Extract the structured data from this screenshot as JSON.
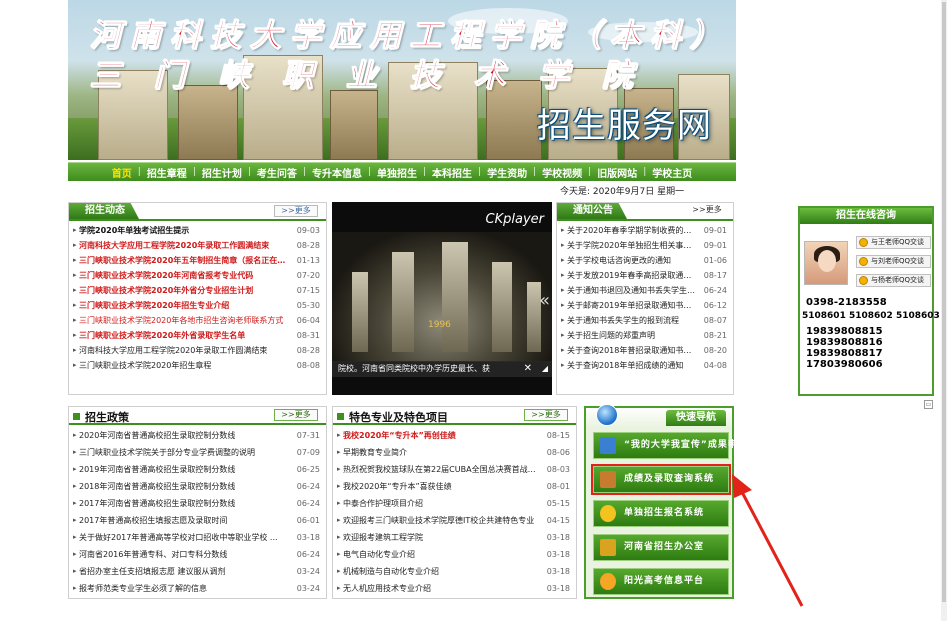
{
  "banner": {
    "title_line1": "河南科技大学应用工程学院（本科）",
    "title_line2": "三门峡职业技术学院",
    "service_title": "招生服务网"
  },
  "nav": {
    "items": [
      "首页",
      "招生章程",
      "招生计划",
      "考生问答",
      "专升本信息",
      "单独招生",
      "本科招生",
      "学生资助",
      "学校视频",
      "旧版网站",
      "学校主页"
    ]
  },
  "date_text": "今天是: 2020年9月7日 星期一",
  "news": {
    "title": "招生动态",
    "more": ">>更多",
    "items": [
      {
        "text": "学院2020年单独考试招生提示",
        "date": "09-03",
        "style": "bold"
      },
      {
        "text": "河南科技大学应用工程学院2020年录取工作圆满结束",
        "date": "08-28",
        "style": "red"
      },
      {
        "text": "三门峡职业技术学院2020年五年制招生简章（报名正在进行中）",
        "date": "01-13",
        "style": "red"
      },
      {
        "text": "三门峡职业技术学院2020年河南省报考专业代码",
        "date": "07-20",
        "style": "red"
      },
      {
        "text": "三门峡职业技术学院2020年外省分专业招生计划",
        "date": "07-15",
        "style": "red"
      },
      {
        "text": "三门峡职业技术学院2020年招生专业介绍",
        "date": "05-30",
        "style": "red"
      },
      {
        "text": "三门峡职业技术学院2020年各地市招生咨询老师联系方式",
        "date": "06-04",
        "style": "redn"
      },
      {
        "text": "三门峡职业技术学院2020年外省录取学生名单",
        "date": "08-31",
        "style": "red"
      },
      {
        "text": "河南科技大学应用工程学院2020年录取工作圆满结束",
        "date": "08-28",
        "style": "normal"
      },
      {
        "text": "三门峡职业技术学院2020年招生章程",
        "date": "08-08",
        "style": "normal"
      }
    ]
  },
  "video": {
    "player_label": "CKplayer",
    "year_text": "1996",
    "caption": "院校。河南省同类院校中办学历史最长、获",
    "close": "✕",
    "arrow": "«"
  },
  "notices": {
    "title": "通知公告",
    "more": ">>更多",
    "items": [
      {
        "text": "关于2020年春季学期学制收费的声明",
        "date": "09-01"
      },
      {
        "text": "关于学院2020年单独招生相关事宜的 ...",
        "date": "09-01"
      },
      {
        "text": "关于学校电话咨询更改的通知",
        "date": "01-06"
      },
      {
        "text": "关于发放2019年春季高招录取通知书的通",
        "date": "08-17"
      },
      {
        "text": "关于通知书退回及通知书丢失学生报 ...",
        "date": "06-24"
      },
      {
        "text": "关于邮寄2019年单招录取通知书的通",
        "date": "06-12"
      },
      {
        "text": "关于通知书丢失学生的报到流程",
        "date": "08-07"
      },
      {
        "text": "关于招生问题的郑重声明",
        "date": "08-21"
      },
      {
        "text": "关于查询2018年普招录取通知书发放 ...",
        "date": "08-20"
      },
      {
        "text": "关于查询2018年单招成绩的通知",
        "date": "04-08"
      }
    ]
  },
  "policy": {
    "title": "招生政策",
    "more": ">>更多",
    "items": [
      {
        "text": "2020年河南省普通高校招生录取控制分数线",
        "date": "07-31"
      },
      {
        "text": "三门峡职业技术学院关于部分专业学费调整的说明",
        "date": "07-09"
      },
      {
        "text": "2019年河南省普通高校招生录取控制分数线",
        "date": "06-25"
      },
      {
        "text": "2018年河南省普通高校招生录取控制分数线",
        "date": "06-24"
      },
      {
        "text": "2017年河南省普通高校招生录取控制分数线",
        "date": "06-24"
      },
      {
        "text": "2017年普通高校招生填报志愿及录取时间",
        "date": "06-01"
      },
      {
        "text": "关于做好2017年普通高等学校对口招收中等职业学校 ...",
        "date": "03-18"
      },
      {
        "text": "河南省2016年普通专科、对口专科分数线",
        "date": "06-24"
      },
      {
        "text": "省招办室主任支招填报志愿 建议服从调剂",
        "date": "03-24"
      },
      {
        "text": "报考师范类专业学生必须了解的信息",
        "date": "03-24"
      }
    ]
  },
  "majors": {
    "title": "特色专业及特色项目",
    "more": ">>更多",
    "items": [
      {
        "text": "我校2020年“专升本”再创佳绩",
        "date": "08-15",
        "style": "red"
      },
      {
        "text": "早期教育专业简介",
        "date": "08-06",
        "style": "normal"
      },
      {
        "text": "热烈祝贺我校篮球队在第22届CUBA全国总决赛首战告 ...",
        "date": "08-03",
        "style": "normal"
      },
      {
        "text": "我校2020年“专升本”喜获佳绩",
        "date": "08-01",
        "style": "normal"
      },
      {
        "text": "中泰合作护理项目介绍",
        "date": "05-15",
        "style": "normal"
      },
      {
        "text": "欢迎报考三门峡职业技术学院厚德IT校企共建特色专业",
        "date": "04-15",
        "style": "normal"
      },
      {
        "text": "欢迎报考建筑工程学院",
        "date": "03-18",
        "style": "normal"
      },
      {
        "text": "电气自动化专业介绍",
        "date": "03-18",
        "style": "normal"
      },
      {
        "text": "机械制造与自动化专业介绍",
        "date": "03-18",
        "style": "normal"
      },
      {
        "text": "无人机应用技术专业介绍",
        "date": "03-18",
        "style": "normal"
      }
    ]
  },
  "quick_nav": {
    "title": "快速导航",
    "buttons": [
      {
        "label": "“我的大学我宣传”成果申报",
        "icon": "monitor-icon"
      },
      {
        "label": "成绩及录取查询系统",
        "icon": "books-icon",
        "highlight": true
      },
      {
        "label": "单独招生报名系统",
        "icon": "person-icon"
      },
      {
        "label": "河南省招生办公室",
        "icon": "book-icon"
      },
      {
        "label": "阳光高考信息平台",
        "icon": "sun-icon"
      }
    ]
  },
  "consult": {
    "title": "招生在线咨询",
    "qq_buttons": [
      "与王老师QQ交谈",
      "与刘老师QQ交谈",
      "与杨老师QQ交谈"
    ],
    "phones": [
      "0398-2183558",
      "5108601 5108602 5108603",
      "19839808815",
      "19839808816",
      "19839808817",
      "17803980606"
    ]
  },
  "colors": {
    "brand_green": "#3d8f1e",
    "highlight_red": "#d01a1a",
    "annotation_red": "#e2231a"
  }
}
